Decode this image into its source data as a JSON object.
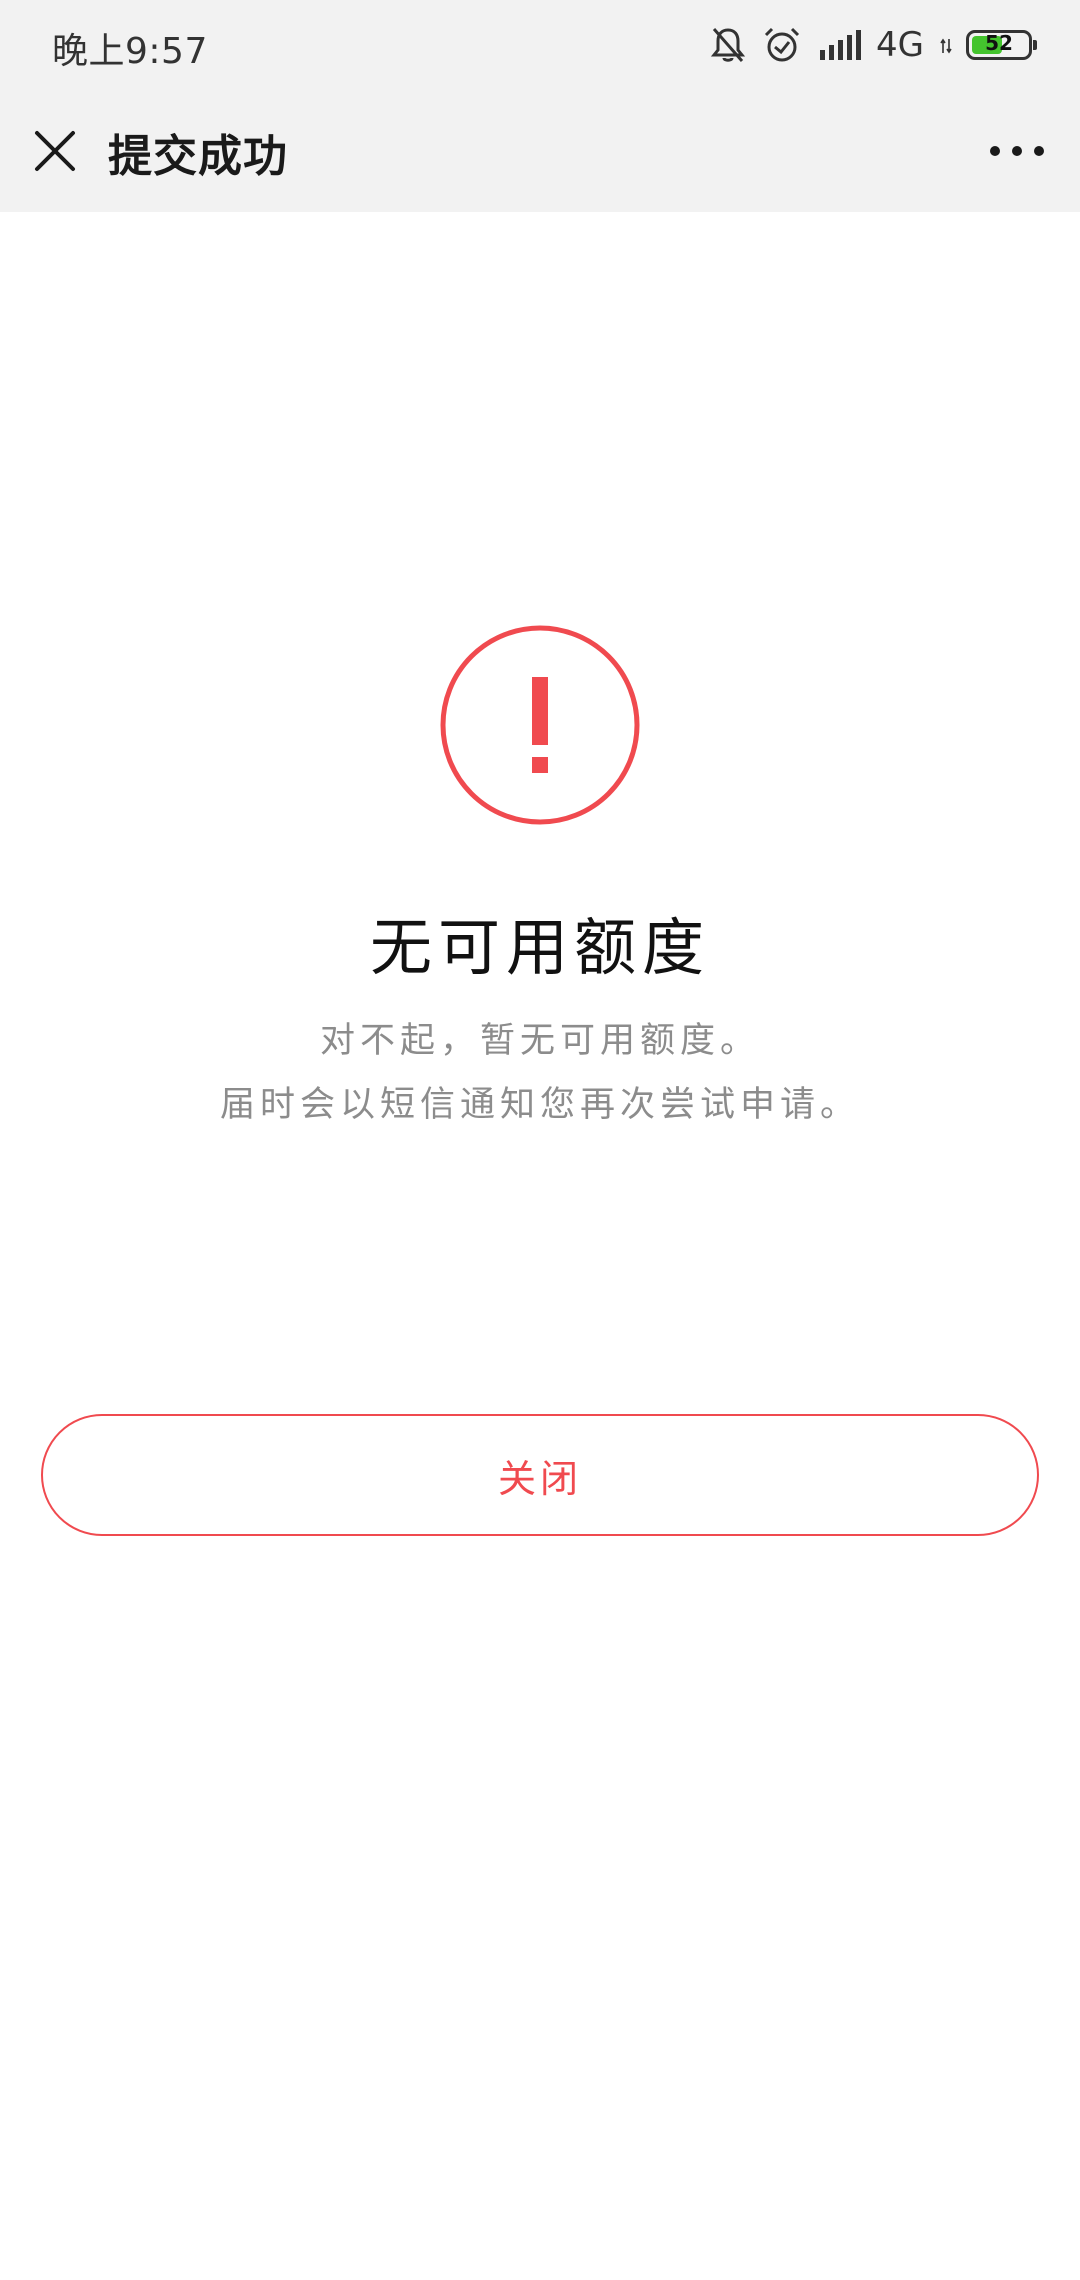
{
  "status_bar": {
    "time": "晚上9:57",
    "network": "4G",
    "battery_level": "52",
    "icons": [
      "bell-muted-icon",
      "alarm-icon",
      "signal-icon",
      "battery-icon"
    ]
  },
  "nav": {
    "title": "提交成功",
    "icons": [
      "close-icon",
      "more-icon"
    ]
  },
  "result": {
    "icon": "exclamation-icon",
    "title": "无可用额度",
    "line1": "对不起，暂无可用额度。",
    "line2": "届时会以短信通知您再次尝试申请。"
  },
  "actions": {
    "close_label": "关闭"
  },
  "colors": {
    "accent": "#f04a4f",
    "nav_background": "#f2f2f2",
    "secondary_text": "#8c8c8c"
  }
}
